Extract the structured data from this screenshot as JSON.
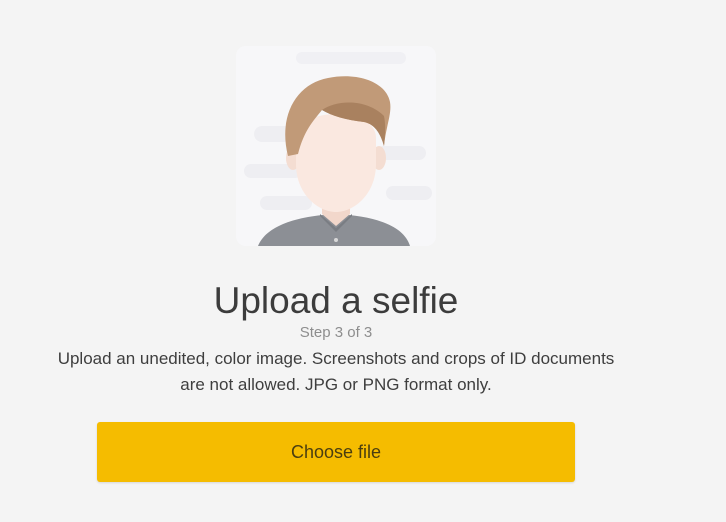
{
  "upload": {
    "title": "Upload a selfie",
    "step": "Step 3 of 3",
    "description": "Upload an unedited, color image. Screenshots and crops of ID documents are not allowed. JPG or PNG format only.",
    "choose_file_label": "Choose file",
    "illustration_icon": "selfie-avatar-icon"
  },
  "colors": {
    "page_background": "#f4f4f4",
    "button_accent": "#f5bc00",
    "title_text": "#3c3c3c"
  }
}
